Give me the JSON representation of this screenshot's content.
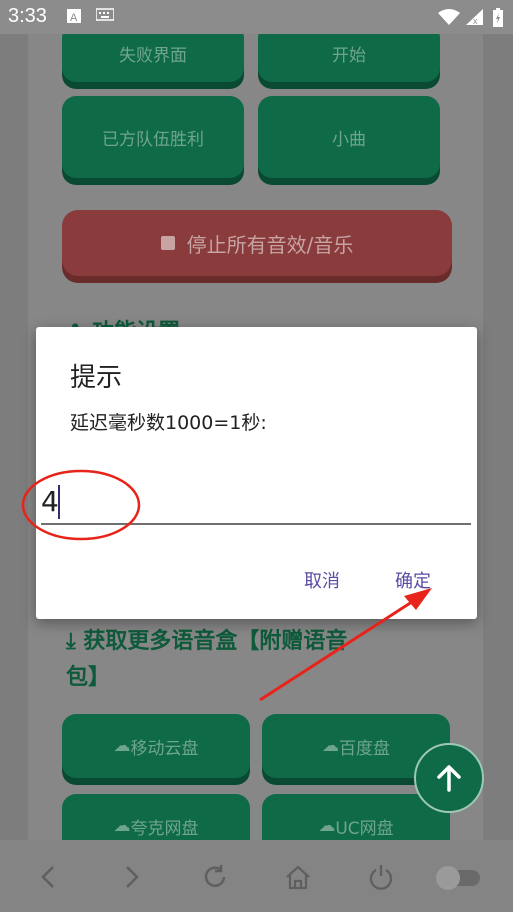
{
  "status_bar": {
    "time": "3:33",
    "icons": [
      "text-input-icon",
      "keyboard-icon",
      "wifi-icon",
      "signal-icon",
      "battery-icon"
    ]
  },
  "background_buttons": {
    "row1": [
      "失败界面",
      "开始"
    ],
    "row2": [
      "已方队伍胜利",
      "小曲"
    ],
    "stop_all": "停止所有音效/音乐",
    "row3": [
      "移动云盘",
      "百度盘"
    ],
    "row4": [
      "夸克网盘",
      "UC网盘"
    ]
  },
  "sections": {
    "settings_title": "功能设置",
    "more_title_line1": "获取更多语音盒【附赠语音",
    "more_title_line2": "包】"
  },
  "dialog": {
    "title": "提示",
    "message": "延迟毫秒数1000=1秒:",
    "input_value": "4",
    "cancel_label": "取消",
    "confirm_label": "确定"
  },
  "colors": {
    "accent_green": "#0f6a47",
    "stop_red": "#8a3b3b",
    "dialog_button": "#5a4ba5",
    "annotation_red": "#e8231a"
  }
}
